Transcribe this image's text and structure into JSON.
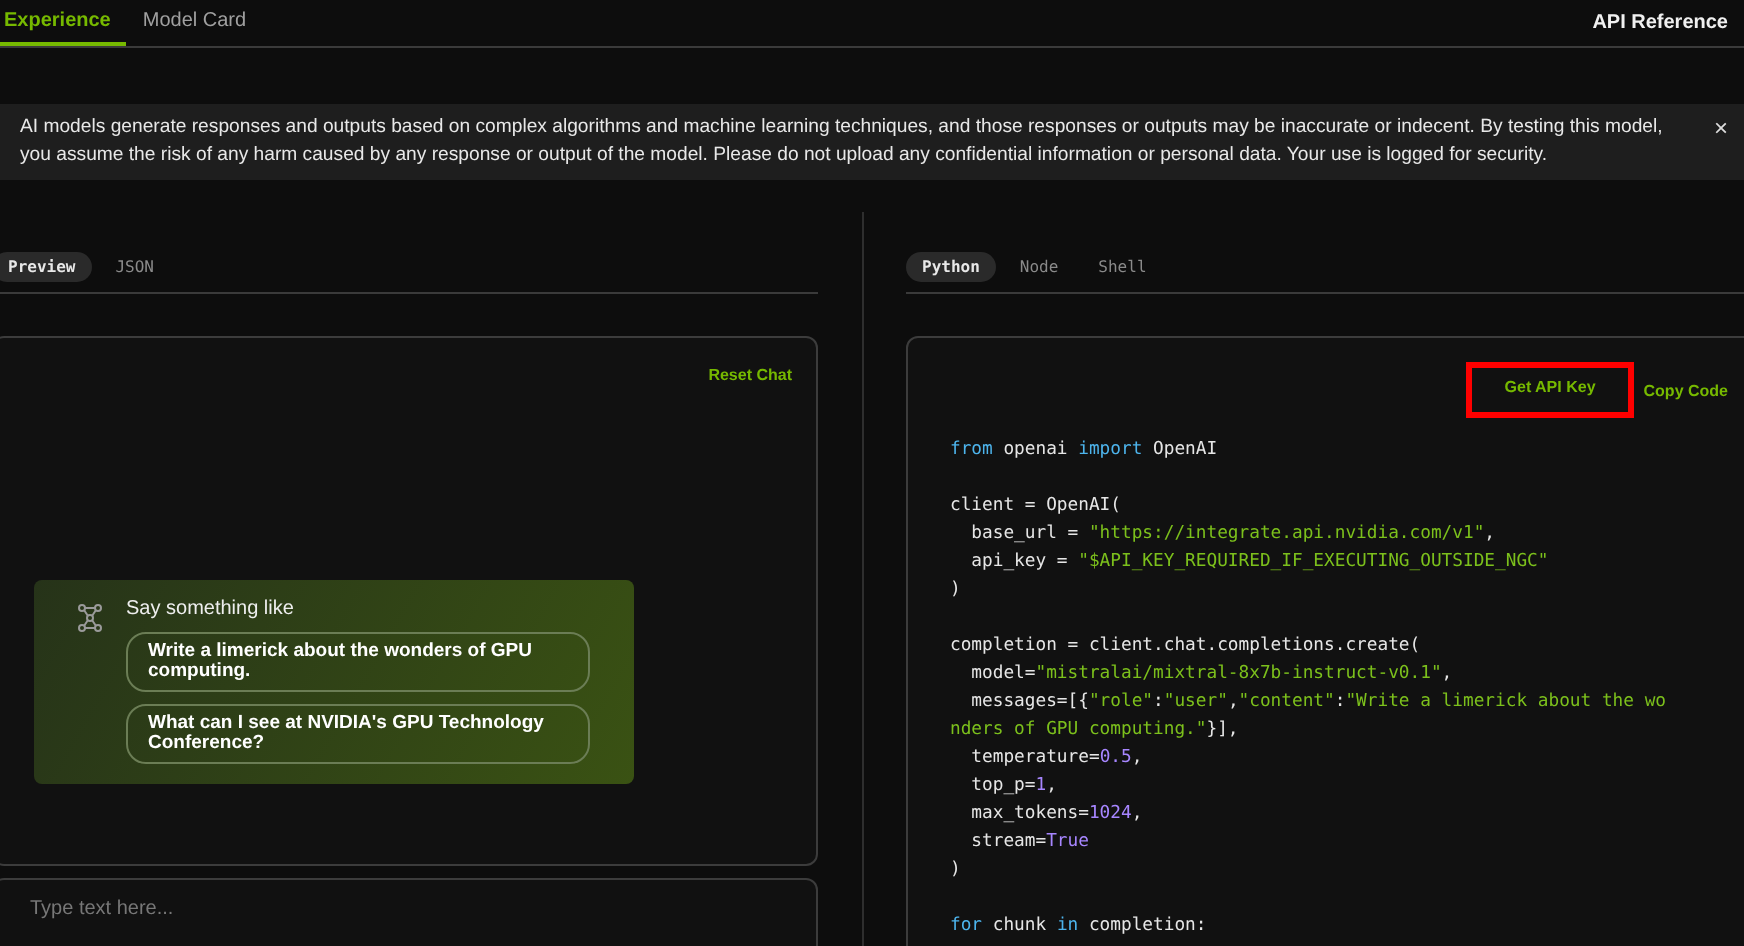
{
  "nav": {
    "tabs": [
      {
        "label": "Experience",
        "selected": true
      },
      {
        "label": "Model Card",
        "selected": false
      }
    ],
    "link": "API Reference"
  },
  "notice": {
    "text": "AI models generate responses and outputs based on complex algorithms and machine learning techniques, and those responses or outputs may be inaccurate or indecent. By testing this model, you assume the risk of any harm caused by any response or output of the model. Please do not upload any confidential information or personal data. Your use is logged for security.",
    "close": "×"
  },
  "preview_panel": {
    "tabs": [
      {
        "label": "Preview",
        "selected": true
      },
      {
        "label": "JSON",
        "selected": false
      }
    ],
    "reset": "Reset Chat",
    "suggestions": {
      "title": "Say something like",
      "items": [
        "Write a limerick about the wonders of GPU computing.",
        "What can I see at NVIDIA's GPU Technology Conference?"
      ]
    },
    "input": {
      "placeholder": "Type text here..."
    }
  },
  "code_panel": {
    "tabs": [
      {
        "label": "Python",
        "selected": true
      },
      {
        "label": "Node",
        "selected": false
      },
      {
        "label": "Shell",
        "selected": false
      }
    ],
    "actions": [
      {
        "label": "Get API Key",
        "highlighted": true
      },
      {
        "label": "Copy Code",
        "highlighted": false
      }
    ],
    "blocks": [
      [
        [
          {
            "kind": "keyword",
            "text": "from"
          },
          {
            "kind": "plain",
            "text": " openai "
          },
          {
            "kind": "keyword",
            "text": "import"
          },
          {
            "kind": "plain",
            "text": " OpenAI"
          }
        ]
      ],
      [
        [
          {
            "kind": "plain",
            "text": "client = OpenAI("
          }
        ],
        [
          {
            "kind": "plain",
            "text": "  base_url = "
          },
          {
            "kind": "string",
            "text": "\"https://integrate.api.nvidia.com/v1\""
          },
          {
            "kind": "plain",
            "text": ","
          }
        ],
        [
          {
            "kind": "plain",
            "text": "  api_key = "
          },
          {
            "kind": "string",
            "text": "\"$API_KEY_REQUIRED_IF_EXECUTING_OUTSIDE_NGC\""
          }
        ],
        [
          {
            "kind": "plain",
            "text": ")"
          }
        ]
      ],
      [
        [
          {
            "kind": "plain",
            "text": "completion = client.chat.completions.create("
          }
        ],
        [
          {
            "kind": "plain",
            "text": "  model="
          },
          {
            "kind": "string",
            "text": "\"mistralai/mixtral-8x7b-instruct-v0.1\""
          },
          {
            "kind": "plain",
            "text": ","
          }
        ],
        [
          {
            "kind": "plain",
            "text": "  messages=[{"
          },
          {
            "kind": "string",
            "text": "\"role\""
          },
          {
            "kind": "plain",
            "text": ":"
          },
          {
            "kind": "string",
            "text": "\"user\""
          },
          {
            "kind": "plain",
            "text": ","
          },
          {
            "kind": "string",
            "text": "\"content\""
          },
          {
            "kind": "plain",
            "text": ":"
          },
          {
            "kind": "string",
            "text": "\"Write a limerick about the wo"
          }
        ],
        [
          {
            "kind": "string",
            "text": "nders of GPU computing.\""
          },
          {
            "kind": "plain",
            "text": "}],"
          }
        ],
        [
          {
            "kind": "plain",
            "text": "  temperature="
          },
          {
            "kind": "number",
            "text": "0.5"
          },
          {
            "kind": "plain",
            "text": ","
          }
        ],
        [
          {
            "kind": "plain",
            "text": "  top_p="
          },
          {
            "kind": "number",
            "text": "1"
          },
          {
            "kind": "plain",
            "text": ","
          }
        ],
        [
          {
            "kind": "plain",
            "text": "  max_tokens="
          },
          {
            "kind": "number",
            "text": "1024"
          },
          {
            "kind": "plain",
            "text": ","
          }
        ],
        [
          {
            "kind": "plain",
            "text": "  stream="
          },
          {
            "kind": "number",
            "text": "True"
          }
        ],
        [
          {
            "kind": "plain",
            "text": ")"
          }
        ]
      ],
      [
        [
          {
            "kind": "keyword",
            "text": "for"
          },
          {
            "kind": "plain",
            "text": " chunk "
          },
          {
            "kind": "keyword",
            "text": "in"
          },
          {
            "kind": "plain",
            "text": " completion:"
          }
        ]
      ]
    ]
  }
}
